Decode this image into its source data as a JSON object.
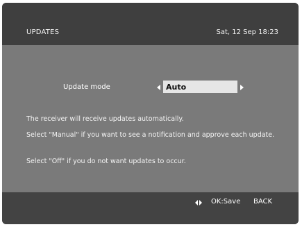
{
  "header": {
    "title": "UPDATES",
    "datetime": "Sat, 12 Sep 18:23"
  },
  "setting": {
    "label": "Update mode",
    "value": "Auto"
  },
  "description": {
    "line1": "The receiver will receive updates automatically.",
    "line2": "Select \"Manual\" if you want to see a notification and approve each update.",
    "line3": "Select \"Off\" if you do not want updates to occur."
  },
  "footer": {
    "nav_icon": "left-right-arrows-icon",
    "ok_label": "OK:Save",
    "back_label": "BACK"
  },
  "colors": {
    "header_bg": "#3f3f3f",
    "content_bg": "#7a7a7a",
    "value_box_bg": "#e6e6e6",
    "footer_bg": "#434343"
  }
}
